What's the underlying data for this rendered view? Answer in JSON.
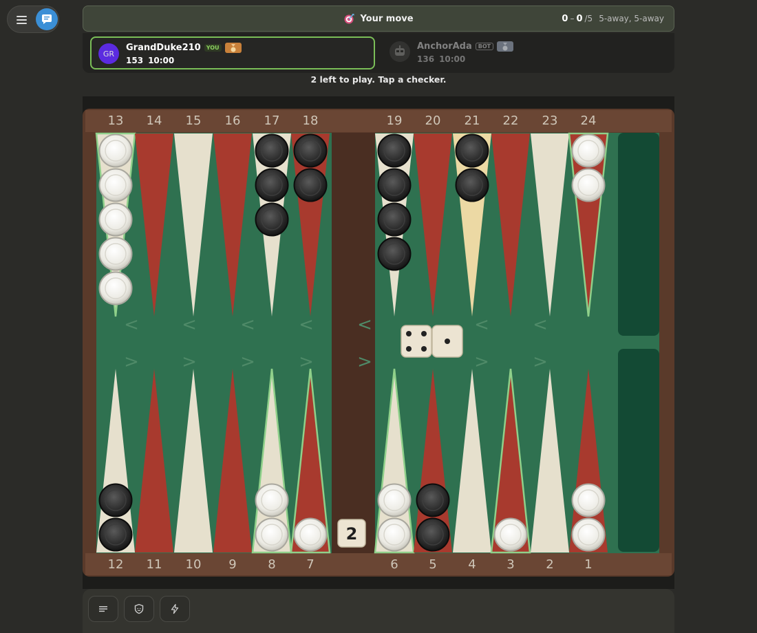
{
  "status": {
    "message": "Your move",
    "score_self": "0",
    "score_sep": "–",
    "score_opp": "0",
    "match_to": "/5",
    "away_text": "5-away, 5-away"
  },
  "player": {
    "initials": "GR",
    "name": "GrandDuke210",
    "badge": "YOU",
    "pips": "153",
    "clock": "10:00"
  },
  "opponent": {
    "name": "AnchorAda",
    "badge": "BOT",
    "pips": "136",
    "clock": "10:00"
  },
  "hint": "2 left to play. Tap a checker.",
  "board": {
    "top_points": [
      "13",
      "14",
      "15",
      "16",
      "17",
      "18",
      "19",
      "20",
      "21",
      "22",
      "23",
      "24"
    ],
    "bottom_points": [
      "12",
      "11",
      "10",
      "9",
      "8",
      "7",
      "6",
      "5",
      "4",
      "3",
      "2",
      "1"
    ],
    "checkers": [
      {
        "point": 13,
        "color": "white",
        "count": 5
      },
      {
        "point": 17,
        "color": "black",
        "count": 3
      },
      {
        "point": 18,
        "color": "black",
        "count": 2
      },
      {
        "point": 19,
        "color": "black",
        "count": 4
      },
      {
        "point": 21,
        "color": "black",
        "count": 2
      },
      {
        "point": 24,
        "color": "white",
        "count": 2
      },
      {
        "point": 12,
        "color": "black",
        "count": 2
      },
      {
        "point": 8,
        "color": "white",
        "count": 2
      },
      {
        "point": 7,
        "color": "white",
        "count": 1
      },
      {
        "point": 6,
        "color": "white",
        "count": 2
      },
      {
        "point": 5,
        "color": "black",
        "count": 2
      },
      {
        "point": 3,
        "color": "white",
        "count": 1
      },
      {
        "point": 1,
        "color": "white",
        "count": 2
      }
    ],
    "highlighted_points": [
      13,
      24,
      8,
      7,
      6,
      3
    ],
    "selected_point": 21,
    "dice": [
      4,
      1
    ],
    "cube_value": "2",
    "colors": {
      "felt": "#2f7150",
      "red_point": "#a83a2e",
      "cream_point": "#e6e0cd",
      "highlight": "#8fd08a",
      "wood": "#5a3a2a",
      "tray": "#134a34"
    }
  },
  "toolbar": {
    "buttons": [
      "list-icon",
      "shield-icon",
      "bolt-icon"
    ]
  }
}
